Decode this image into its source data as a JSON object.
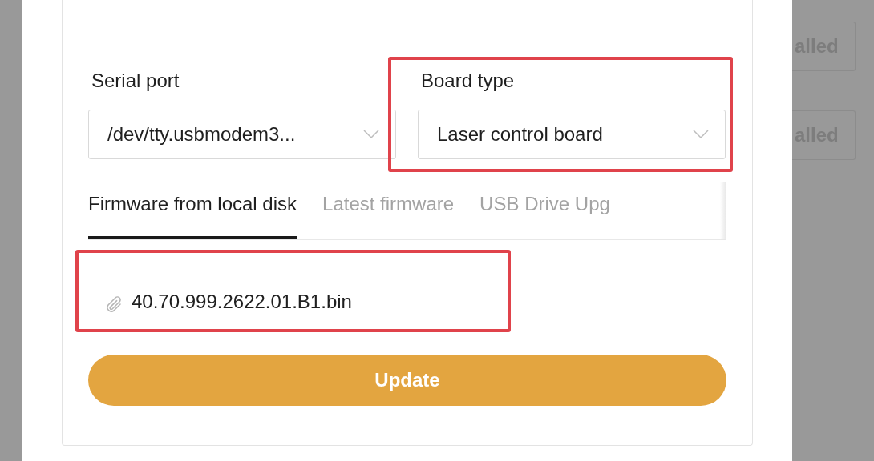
{
  "fields": [
    {
      "label": "Serial port",
      "value": "/dev/tty.usbmodem3...",
      "highlighted": false
    },
    {
      "label": "Board type",
      "value": "Laser control board",
      "highlighted": true
    }
  ],
  "tabs": [
    {
      "label": "Firmware from local disk",
      "selected": true
    },
    {
      "label": "Latest firmware",
      "selected": false
    },
    {
      "label": "USB Drive Upg",
      "selected": false
    }
  ],
  "file": {
    "name": "40.70.999.2622.01.B1.bin",
    "highlighted": true
  },
  "update_button": "Update",
  "background_buttons": [
    "alled",
    "alled"
  ]
}
